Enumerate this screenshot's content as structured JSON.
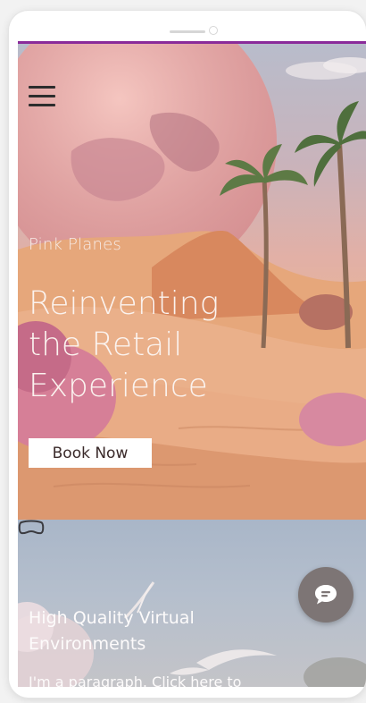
{
  "hero": {
    "eyebrow": "Pink Planes",
    "headline_lines": [
      "Reinventing",
      "the Retail",
      "Experience"
    ],
    "cta_label": "Book Now"
  },
  "section2": {
    "icon": "vr-headset-icon",
    "title_lines": [
      "High Quality Virtual",
      "Environments"
    ],
    "paragraph_visible": "I'm a paragraph. Click here to"
  },
  "chat": {
    "icon": "chat-bubble-icon"
  },
  "menu": {
    "icon": "hamburger-menu-icon"
  },
  "colors": {
    "accent_line": "#8a2b9a",
    "chat_button": "#7d7575",
    "cta_background": "#ffffff"
  }
}
